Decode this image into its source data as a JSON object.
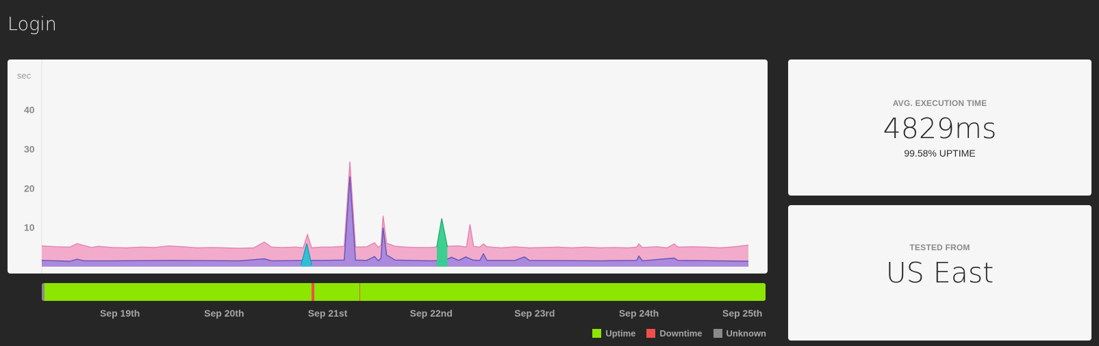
{
  "page": {
    "title": "Login"
  },
  "chart_data": {
    "type": "area",
    "ylabel": "sec",
    "yticks": [
      40,
      30,
      20,
      10
    ],
    "ylim": [
      0,
      45
    ],
    "xlim": [
      0,
      100
    ],
    "grid": false,
    "x_ticks": [
      {
        "label": "Sep 19th",
        "x": 10.8
      },
      {
        "label": "Sep 20th",
        "x": 25.2
      },
      {
        "label": "Sep 21st",
        "x": 39.5
      },
      {
        "label": "Sep 22nd",
        "x": 53.8
      },
      {
        "label": "Sep 23rd",
        "x": 68.1
      },
      {
        "label": "Sep 24th",
        "x": 82.5
      },
      {
        "label": "Sep 25th",
        "x": 96.8
      }
    ],
    "series": [
      {
        "color": "#f2a6c8",
        "stroke": "#e682b0",
        "points": [
          [
            0,
            5.3
          ],
          [
            2,
            5.1
          ],
          [
            4,
            5.0
          ],
          [
            5,
            5.9
          ],
          [
            6,
            5.4
          ],
          [
            7,
            4.9
          ],
          [
            8,
            5.2
          ],
          [
            10,
            4.9
          ],
          [
            12,
            4.8
          ],
          [
            14,
            5.0
          ],
          [
            16,
            4.9
          ],
          [
            18,
            5.3
          ],
          [
            20,
            5.1
          ],
          [
            22,
            4.8
          ],
          [
            24,
            4.9
          ],
          [
            26,
            4.8
          ],
          [
            28,
            4.7
          ],
          [
            30,
            4.8
          ],
          [
            31.5,
            6.3
          ],
          [
            32.5,
            5.0
          ],
          [
            34,
            4.9
          ],
          [
            36,
            5.0
          ],
          [
            37,
            4.8
          ],
          [
            37.6,
            8.2
          ],
          [
            38.2,
            4.8
          ],
          [
            39.5,
            5.0
          ],
          [
            41,
            5.0
          ],
          [
            42.8,
            5.2
          ],
          [
            43.6,
            26.8
          ],
          [
            44.4,
            5.0
          ],
          [
            46,
            5.1
          ],
          [
            47.1,
            6.1
          ],
          [
            47.6,
            4.9
          ],
          [
            48,
            5.5
          ],
          [
            48.3,
            13.0
          ],
          [
            48.8,
            6.0
          ],
          [
            50,
            5.2
          ],
          [
            51.5,
            5.0
          ],
          [
            53,
            4.9
          ],
          [
            55,
            4.9
          ],
          [
            57,
            5.2
          ],
          [
            59,
            5.3
          ],
          [
            60.1,
            5.0
          ],
          [
            60.6,
            10.8
          ],
          [
            61.1,
            5.2
          ],
          [
            62,
            5.0
          ],
          [
            62.5,
            5.8
          ],
          [
            63,
            5.1
          ],
          [
            65,
            4.8
          ],
          [
            67,
            5.1
          ],
          [
            69,
            4.8
          ],
          [
            71,
            4.9
          ],
          [
            73,
            5.0
          ],
          [
            75,
            4.8
          ],
          [
            77,
            5.0
          ],
          [
            79,
            4.8
          ],
          [
            81,
            4.9
          ],
          [
            83,
            4.8
          ],
          [
            84.2,
            5.0
          ],
          [
            84.5,
            5.8
          ],
          [
            85,
            4.9
          ],
          [
            87,
            5.1
          ],
          [
            88.5,
            4.8
          ],
          [
            89.5,
            5.8
          ],
          [
            90,
            5.0
          ],
          [
            92,
            5.1
          ],
          [
            94,
            5.0
          ],
          [
            96,
            4.8
          ],
          [
            98,
            5.1
          ],
          [
            100,
            5.5
          ]
        ]
      },
      {
        "color": "#a687dc",
        "stroke": "#5f55b8",
        "points": [
          [
            0,
            1.6
          ],
          [
            4,
            1.4
          ],
          [
            5,
            1.9
          ],
          [
            6,
            1.5
          ],
          [
            10,
            1.5
          ],
          [
            18,
            1.6
          ],
          [
            28,
            1.5
          ],
          [
            31.5,
            2.0
          ],
          [
            32.5,
            1.5
          ],
          [
            37,
            1.6
          ],
          [
            39.5,
            1.6
          ],
          [
            42.8,
            1.7
          ],
          [
            43.6,
            23.0
          ],
          [
            44.4,
            1.7
          ],
          [
            46,
            1.6
          ],
          [
            47.1,
            2.6
          ],
          [
            47.6,
            1.5
          ],
          [
            48,
            2.2
          ],
          [
            48.3,
            10.0
          ],
          [
            48.8,
            3.0
          ],
          [
            50,
            1.7
          ],
          [
            55,
            1.5
          ],
          [
            57,
            1.6
          ],
          [
            58,
            2.4
          ],
          [
            59,
            1.6
          ],
          [
            60,
            2.5
          ],
          [
            61,
            1.7
          ],
          [
            62,
            1.6
          ],
          [
            62.5,
            3.3
          ],
          [
            63,
            1.6
          ],
          [
            67,
            1.6
          ],
          [
            68.3,
            2.5
          ],
          [
            69,
            1.6
          ],
          [
            79,
            1.5
          ],
          [
            84.2,
            1.6
          ],
          [
            84.5,
            2.7
          ],
          [
            85,
            1.5
          ],
          [
            89.5,
            2.2
          ],
          [
            90,
            1.6
          ],
          [
            100,
            1.4
          ]
        ]
      },
      {
        "color": "#2bc0d4",
        "stroke": "#1a9fb4",
        "points": [
          [
            36.7,
            0.5
          ],
          [
            37.5,
            5.9
          ],
          [
            38.2,
            0.5
          ]
        ]
      },
      {
        "color": "#34d08c",
        "stroke": "#1fae6e",
        "points": [
          [
            55.9,
            5.0
          ],
          [
            56.6,
            12.3
          ],
          [
            57.4,
            5.0
          ]
        ]
      }
    ]
  },
  "status_timeline": [
    {
      "status": "unknown",
      "start": 0,
      "end": 0.4
    },
    {
      "status": "uptime",
      "start": 0.4,
      "end": 37.3
    },
    {
      "status": "downtime",
      "start": 37.3,
      "end": 37.65
    },
    {
      "status": "uptime",
      "start": 37.65,
      "end": 43.9
    },
    {
      "status": "downtime",
      "start": 43.9,
      "end": 44.0
    },
    {
      "status": "uptime",
      "start": 44.0,
      "end": 100
    }
  ],
  "legend": [
    {
      "label": "Uptime",
      "color": "#8ce600",
      "icon": "uptime-swatch"
    },
    {
      "label": "Downtime",
      "color": "#f24d4d",
      "icon": "downtime-swatch"
    },
    {
      "label": "Unknown",
      "color": "#8a8a8a",
      "icon": "unknown-swatch"
    }
  ],
  "stats": {
    "exec_label": "AVG. EXECUTION TIME",
    "exec_value": "4829ms",
    "uptime_text": "99.58% UPTIME",
    "region_label": "TESTED FROM",
    "region_value": "US East"
  }
}
